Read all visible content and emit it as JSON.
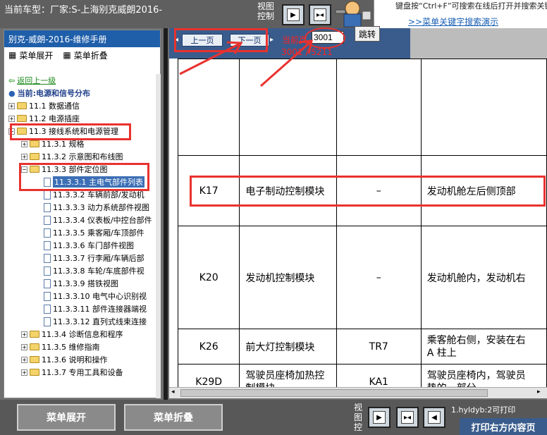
{
  "topbar": {
    "current_car": "当前车型：厂家:S-上海别克威朗2016-",
    "view_control": "视图控制",
    "ad_line1": "键盘按“Ctrl+F”可搜索在线后打开并搜索关键字!",
    "ad_line2": ">>菜单关键字搜索演示"
  },
  "left": {
    "header": "别克-威朗-2016-维修手册",
    "expand_menu": "菜单展开",
    "collapse_menu": "菜单折叠",
    "back": "返回上一级",
    "current": "当前:电源和信号分布",
    "items": [
      "11.1 数据通信",
      "11.2 电源插座",
      "11.3 接线系统和电源管理",
      "11.3.1 规格",
      "11.3.2 示意图和布线图",
      "11.3.3 部件定位图",
      "11.3.3.1 主电气部件列表",
      "11.3.3.2 车辆前部/发动机",
      "11.3.3.3 动力系统部件视图",
      "11.3.3.4 仪表板/中控台部件",
      "11.3.3.5 乘客厢/车顶部件",
      "11.3.3.6 车门部件视图",
      "11.3.3.7 行李厢/车辆后部",
      "11.3.3.8 车轮/车底部件视",
      "11.3.3.9 搭铁视图",
      "11.3.3.10 电气中心识别视",
      "11.3.3.11 部件连接器端视",
      "11.3.3.12 直列式线束连接",
      "11.3.4 诊断信息和程序",
      "11.3.5 维修指南",
      "11.3.6 说明和操作",
      "11.3.7 专用工具和设备"
    ]
  },
  "nav": {
    "prev": "上一页",
    "next": "下一页",
    "current_label": "当前页",
    "page_value": "3001",
    "page_count": "3001 / 5211",
    "jump": "跳转"
  },
  "table": {
    "rows": [
      {
        "code": "",
        "name": "",
        "conn": "",
        "location": ""
      },
      {
        "code": "K17",
        "name": "电子制动控制模块",
        "conn": "–",
        "location": "发动机舱左后侧顶部"
      },
      {
        "code": "K20",
        "name": "发动机控制模块",
        "conn": "–",
        "location": "发动机舱内，发动机右"
      },
      {
        "code": "K26",
        "name": "前大灯控制模块",
        "conn": "TR7",
        "location": "乘客舱右侧，安装在右\nA 柱上"
      },
      {
        "code": "K29D",
        "name": "驾驶员座椅加热控制模块",
        "conn": "KA1",
        "location": "驾驶员座椅内，驾驶员\n垫的一部分"
      }
    ]
  },
  "bottom": {
    "expand_menu": "菜单展开",
    "collapse_menu": "菜单折叠",
    "view_control": "视图控",
    "print_info": "1.hyldyb:2可打印",
    "print_button": "打印右方内容页"
  },
  "colors": {
    "annotation": "#e8322f",
    "header_blue": "#1f5faa",
    "nav_blue": "#3a5c8c"
  }
}
